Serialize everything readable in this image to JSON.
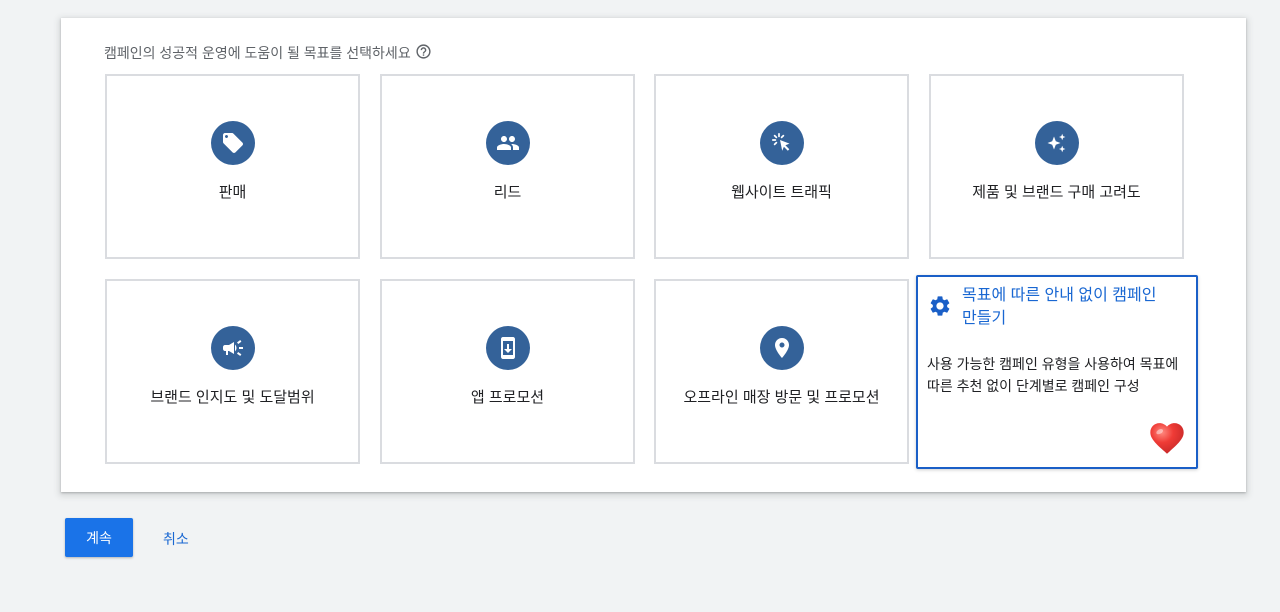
{
  "header": {
    "prompt": "캠페인의 성공적 운영에 도움이 될 목표를 선택하세요",
    "help_icon": "help-outline-icon"
  },
  "goals": [
    {
      "label": "판매",
      "icon": "tag-icon"
    },
    {
      "label": "리드",
      "icon": "people-icon"
    },
    {
      "label": "웹사이트 트래픽",
      "icon": "cursor-click-icon"
    },
    {
      "label": "제품 및 브랜드 구매 고려도",
      "icon": "sparkle-icon"
    },
    {
      "label": "브랜드 인지도 및 도달범위",
      "icon": "megaphone-icon"
    },
    {
      "label": "앱 프로모션",
      "icon": "phone-download-icon"
    },
    {
      "label": "오프라인 매장 방문 및 프로모션",
      "icon": "location-pin-icon"
    }
  ],
  "no_goal_option": {
    "title": "목표에 따른 안내 없이 캠페인 만들기",
    "description": "사용 가능한 캠페인 유형을 사용하여 목표에 따른 추천 없이 단계별로 캠페인 구성",
    "icon": "gear-icon",
    "overlay_icon": "heart-icon",
    "selected": true
  },
  "actions": {
    "continue_label": "계속",
    "cancel_label": "취소"
  },
  "colors": {
    "accent": "#1a73e8",
    "icon_circle": "#346299",
    "selected_title": "#1967d2",
    "selected_border": "#1a5fc7",
    "page_background": "#f1f3f4",
    "heart": "#e53935"
  }
}
